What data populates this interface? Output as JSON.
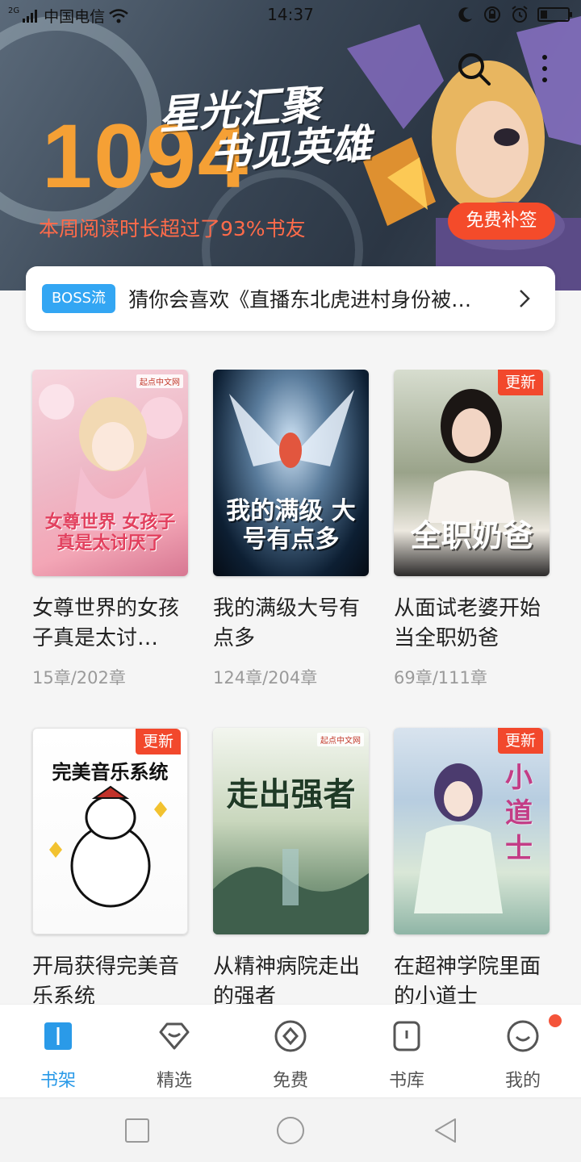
{
  "status_bar": {
    "network_type": "2G",
    "carrier": "中国电信",
    "time": "14:37"
  },
  "banner": {
    "number": "1094",
    "slogan_line1": "星光汇聚",
    "slogan_line2": "书见英雄",
    "subtitle": "本周阅读时长超过了93%书友",
    "checkin_label": "免费补签",
    "accent_color": "#f5a035",
    "button_color": "#f44b2a"
  },
  "recommend": {
    "tag": "BOSS流",
    "text": "猜你会喜欢《直播东北虎进村身份被…"
  },
  "books": [
    {
      "title": "女尊世界的女孩子真是太讨…",
      "progress": "15章/202章",
      "cover_text": "女尊世界 女孩子真是太讨厌了",
      "badge": "",
      "publisher": "起点中文网"
    },
    {
      "title": "我的满级大号有点多",
      "progress": "124章/204章",
      "cover_text": "我的满级 大号有点多",
      "badge": "",
      "publisher": ""
    },
    {
      "title": "从面试老婆开始当全职奶爸",
      "progress": "69章/111章",
      "cover_text": "全职奶爸",
      "badge": "更新",
      "publisher": ""
    },
    {
      "title": "开局获得完美音乐系统",
      "progress": "",
      "cover_text": "完美音乐系统",
      "badge": "更新",
      "publisher": ""
    },
    {
      "title": "从精神病院走出的强者",
      "progress": "",
      "cover_text": "走出强者",
      "badge": "",
      "publisher": "起点中文网"
    },
    {
      "title": "在超神学院里面的小道士",
      "progress": "",
      "cover_text": "小道士",
      "badge": "更新",
      "publisher": ""
    }
  ],
  "bottom_nav": {
    "items": [
      {
        "label": "书架",
        "icon": "bookshelf-icon",
        "active": true
      },
      {
        "label": "精选",
        "icon": "featured-icon",
        "active": false
      },
      {
        "label": "免费",
        "icon": "free-icon",
        "active": false
      },
      {
        "label": "书库",
        "icon": "library-icon",
        "active": false
      },
      {
        "label": "我的",
        "icon": "profile-icon",
        "active": false,
        "notification_dot": true
      }
    ],
    "active_color": "#2a9ae8"
  },
  "system_nav": {
    "buttons": [
      "recent-apps",
      "home",
      "back"
    ]
  }
}
